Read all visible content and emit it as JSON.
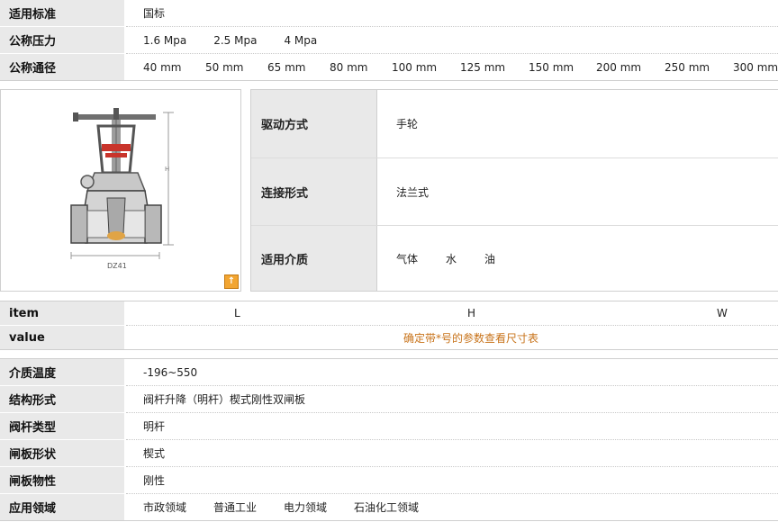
{
  "specs_top": [
    {
      "label": "适用标准",
      "values": [
        "国标"
      ]
    },
    {
      "label": "公称压力",
      "values": [
        "1.6 Mpa",
        "2.5 Mpa",
        "4 Mpa"
      ]
    },
    {
      "label": "公称通径",
      "values": [
        "40 mm",
        "50 mm",
        "65 mm",
        "80 mm",
        "100 mm",
        "125 mm",
        "150 mm",
        "200 mm",
        "250 mm",
        "300 mm"
      ]
    }
  ],
  "product_image": {
    "caption": "DZ41",
    "zoom_icon": "zoom-icon"
  },
  "features": [
    {
      "label": "驱动方式",
      "values": [
        "手轮"
      ]
    },
    {
      "label": "连接形式",
      "values": [
        "法兰式"
      ]
    },
    {
      "label": "适用介质",
      "values": [
        "气体",
        "水",
        "油"
      ]
    }
  ],
  "dimensions": {
    "item_label": "item",
    "columns": [
      "L",
      "H",
      "W"
    ],
    "value_label": "value",
    "value_note": "确定带*号的参数查看尺寸表"
  },
  "specs_bottom": [
    {
      "label": "介质温度",
      "values": [
        "-196~550"
      ]
    },
    {
      "label": "结构形式",
      "values": [
        "阀杆升降（明杆）楔式刚性双闸板"
      ]
    },
    {
      "label": "阀杆类型",
      "values": [
        "明杆"
      ]
    },
    {
      "label": "闸板形状",
      "values": [
        "楔式"
      ]
    },
    {
      "label": "闸板物性",
      "values": [
        "刚性"
      ]
    },
    {
      "label": "应用领域",
      "values": [
        "市政领域",
        "普通工业",
        "电力领域",
        "石油化工领域"
      ]
    }
  ],
  "colors": {
    "label_bg": "#e9e9e9",
    "note": "#c8731a",
    "accent": "#f2a531"
  }
}
